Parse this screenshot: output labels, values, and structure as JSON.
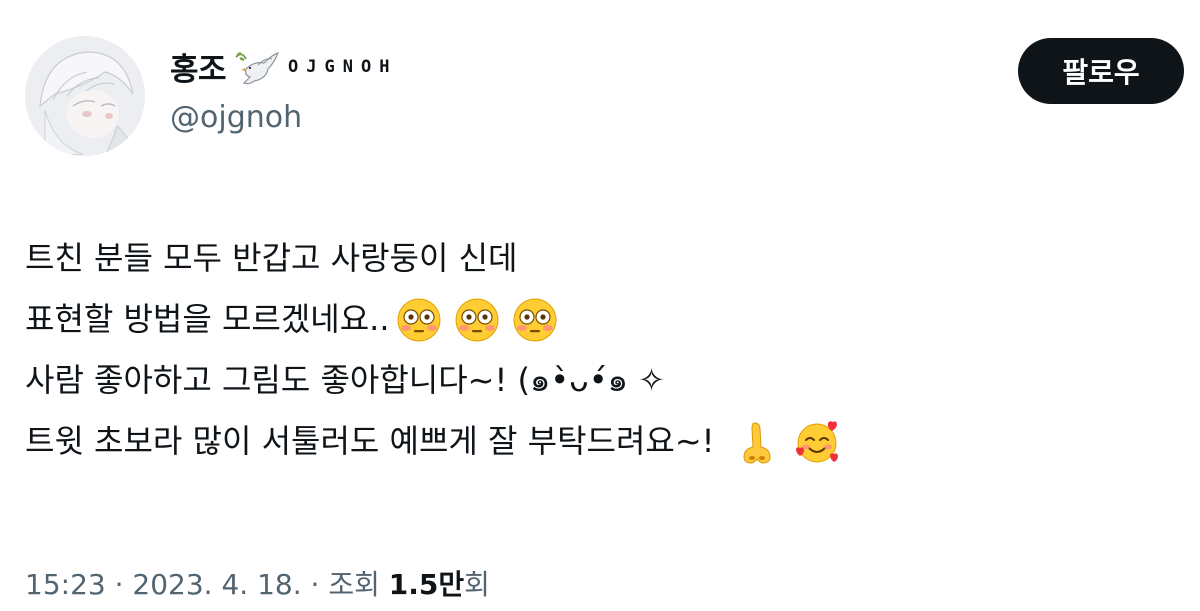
{
  "profile": {
    "display_name": "홍조",
    "name_suffix": "OJGNOH",
    "handle": "@ojgnoh",
    "dove_icon": "dove-with-olive-branch-icon"
  },
  "follow_button": {
    "label": "팔로우"
  },
  "tweet": {
    "line1": "트친 분들 모두 반갑고 사랑둥이 신데",
    "line2": "표현할 방법을 모르겠네요..",
    "line2_emoji": [
      "flushed-face-icon",
      "flushed-face-icon",
      "flushed-face-icon"
    ],
    "line3": "사람 좋아하고 그림도 좋아합니다~! (๑•̀ᴗ•́๑ ✧",
    "line4": "트윗 초보라 많이 서툴러도 예쁘게 잘 부탁드려요~!",
    "line4_emoji": [
      "nose-icon",
      "smiling-face-with-hearts-icon"
    ]
  },
  "meta": {
    "time": "15:23",
    "separator": "·",
    "date": "2023. 4. 18.",
    "views_label": "조회",
    "views_count": "1.5만",
    "views_suffix": "회"
  },
  "colors": {
    "text": "#0f1419",
    "secondary": "#536471",
    "button_bg": "#0f1419"
  }
}
